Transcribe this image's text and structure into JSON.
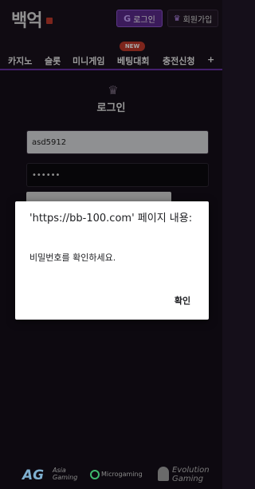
{
  "header": {
    "logo_text": "백억",
    "login_button": {
      "icon": "G",
      "label": "로그인"
    },
    "join_button": {
      "icon": "crown-icon",
      "label": "회원가입"
    }
  },
  "nav": {
    "items": [
      "카지노",
      "슬롯",
      "미니게임",
      "베팅대회",
      "충전신청",
      "+"
    ],
    "badge": "NEW"
  },
  "login": {
    "title": "로그인",
    "username_value": "asd5912",
    "password_value": "••••••"
  },
  "dialog": {
    "title": "'https://bb-100.com' 페이지 내용:",
    "message": "비밀번호를 확인하세요.",
    "ok_label": "확인"
  },
  "footer": {
    "providers": [
      {
        "mark": "AG",
        "name_line1": "Asia",
        "name_line2": "Gaming"
      },
      {
        "name": "Microgaming"
      },
      {
        "name_line1": "Evolution",
        "name_line2": "Gaming"
      }
    ]
  }
}
